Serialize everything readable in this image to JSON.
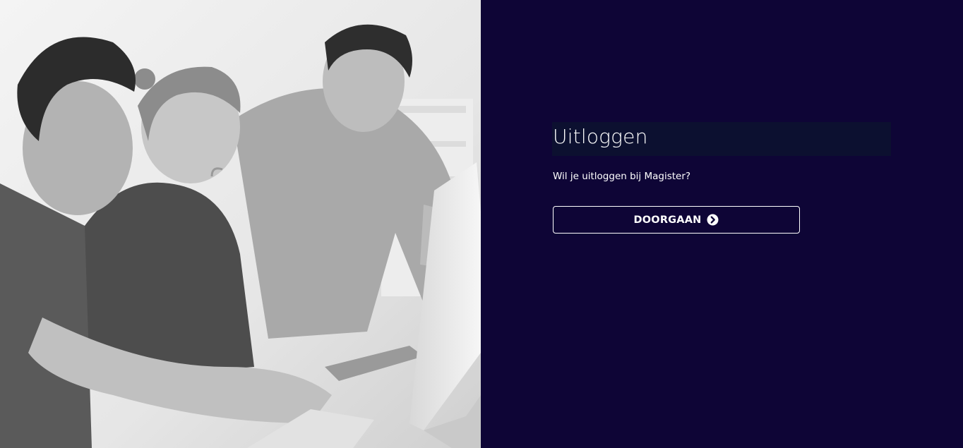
{
  "logout": {
    "title": "Uitloggen",
    "question": "Wil je uitloggen bij Magister?",
    "continue_label": "DOORGAAN",
    "continue_icon": "circle-arrow-right-icon"
  },
  "colors": {
    "panel_background": "#0e0536",
    "title_bar_background": "#0c1030",
    "text": "#ffffff",
    "button_border": "#ffffff"
  },
  "images": {
    "left_photo": "grayscale-photo-three-people-at-computer"
  }
}
